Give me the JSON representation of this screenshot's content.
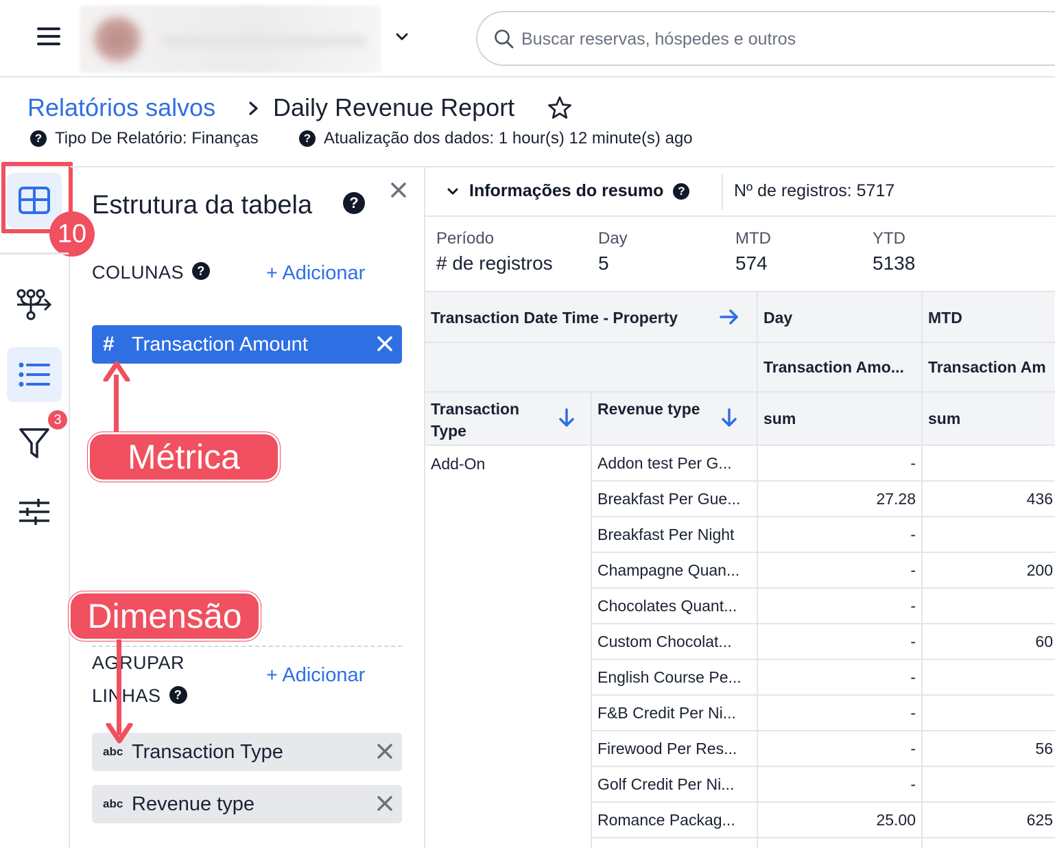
{
  "topbar": {
    "search_placeholder": "Buscar reservas, hóspedes e outros"
  },
  "breadcrumb": {
    "parent": "Relatórios salvos",
    "current": "Daily Revenue Report"
  },
  "meta": {
    "report_type": "Tipo De Relatório: Finanças",
    "data_update": "Atualização dos dados: 1 hour(s) 12 minute(s) ago"
  },
  "rail": {
    "step_badge": "10",
    "filter_count": "3",
    "icons": [
      "table-icon",
      "flow-icon",
      "list-icon",
      "filter-icon",
      "sliders-icon"
    ]
  },
  "panel": {
    "title": "Estrutura da tabela",
    "columns_label": "COLUNAS",
    "add_label": "+ Adicionar",
    "group_label_line1": "AGRUPAR",
    "group_label_line2": "LINHAS",
    "metric_chip": {
      "type": "#",
      "label": "Transaction Amount"
    },
    "dimension_chips": [
      {
        "type": "abc",
        "label": "Transaction Type"
      },
      {
        "type": "abc",
        "label": "Revenue type"
      }
    ]
  },
  "annotations": {
    "metric": "Métrica",
    "dimension": "Dimensão"
  },
  "summary": {
    "toggle_label": "Informações do resumo",
    "records": "Nº de registros: 5717",
    "headers": [
      "Período",
      "Day",
      "MTD",
      "YTD"
    ],
    "row_label": "# de registros",
    "values": [
      "5",
      "574",
      "5138"
    ]
  },
  "table": {
    "col_dimension": "Transaction Date Time - Property",
    "period_headers": [
      "Day",
      "MTD"
    ],
    "measure_headers": [
      "Transaction Amo...",
      "Transaction Am"
    ],
    "row_header_1": "Transaction Type",
    "row_header_2": "Revenue type",
    "agg": [
      "sum",
      "sum"
    ],
    "group": "Add-On",
    "rows": [
      {
        "revenue_type": "Addon test Per G...",
        "day": "-",
        "mtd": ""
      },
      {
        "revenue_type": "Breakfast Per Gue...",
        "day": "27.28",
        "mtd": "436"
      },
      {
        "revenue_type": "Breakfast Per Night",
        "day": "-",
        "mtd": ""
      },
      {
        "revenue_type": "Champagne Quan...",
        "day": "-",
        "mtd": "200"
      },
      {
        "revenue_type": "Chocolates Quant...",
        "day": "-",
        "mtd": ""
      },
      {
        "revenue_type": "Custom Chocolat...",
        "day": "-",
        "mtd": "60"
      },
      {
        "revenue_type": "English Course Pe...",
        "day": "-",
        "mtd": ""
      },
      {
        "revenue_type": "F&B Credit Per Ni...",
        "day": "-",
        "mtd": ""
      },
      {
        "revenue_type": "Firewood Per Res...",
        "day": "-",
        "mtd": "56"
      },
      {
        "revenue_type": "Golf Credit Per Ni...",
        "day": "-",
        "mtd": ""
      },
      {
        "revenue_type": "Romance Packag...",
        "day": "25.00",
        "mtd": "625"
      }
    ]
  },
  "colors": {
    "accent": "#2f6fe4",
    "annotation": "#f0505f"
  }
}
